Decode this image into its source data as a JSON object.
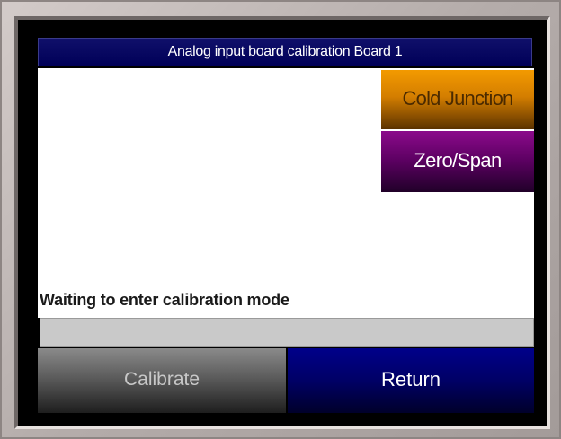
{
  "window": {
    "title": "Analog input board calibration Board 1"
  },
  "buttons": {
    "cold_junction": "Cold Junction",
    "zero_span": "Zero/Span",
    "calibrate": "Calibrate",
    "return": "Return"
  },
  "status": {
    "message": "Waiting to enter calibration mode",
    "progress": 0
  },
  "colors": {
    "title_bar": "#000058",
    "cold_junction": "#f39a00",
    "zero_span": "#6a0070",
    "calibrate": "#5c5c5c",
    "return": "#000070"
  }
}
